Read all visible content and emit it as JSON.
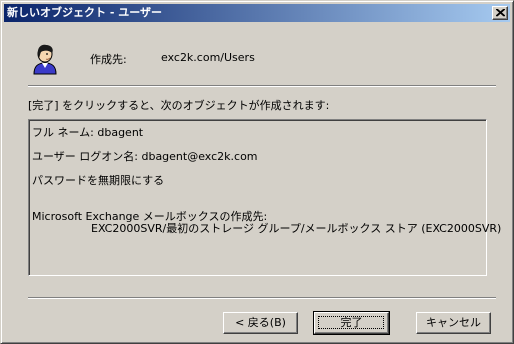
{
  "window": {
    "title": "新しいオブジェクト - ユーザー",
    "close_icon": "close-icon"
  },
  "header": {
    "icon": "user-icon",
    "create_in_label": "作成先:",
    "create_in_value": "exc2k.com/Users"
  },
  "instruction": "[完了] をクリックすると、次のオブジェクトが作成されます:",
  "summary": {
    "full_name": "フル ネーム: dbagent",
    "logon_name": "ユーザー ログオン名: dbagent@exc2k.com",
    "password_option": "パスワードを無期限にする",
    "mailbox_label": "Microsoft Exchange メールボックスの作成先:",
    "mailbox_path": "EXC2000SVR/最初のストレージ グループ/メールボックス ストア (EXC2000SVR)"
  },
  "buttons": {
    "back": "< 戻る(B)",
    "finish": "完了",
    "cancel": "キャンセル"
  }
}
